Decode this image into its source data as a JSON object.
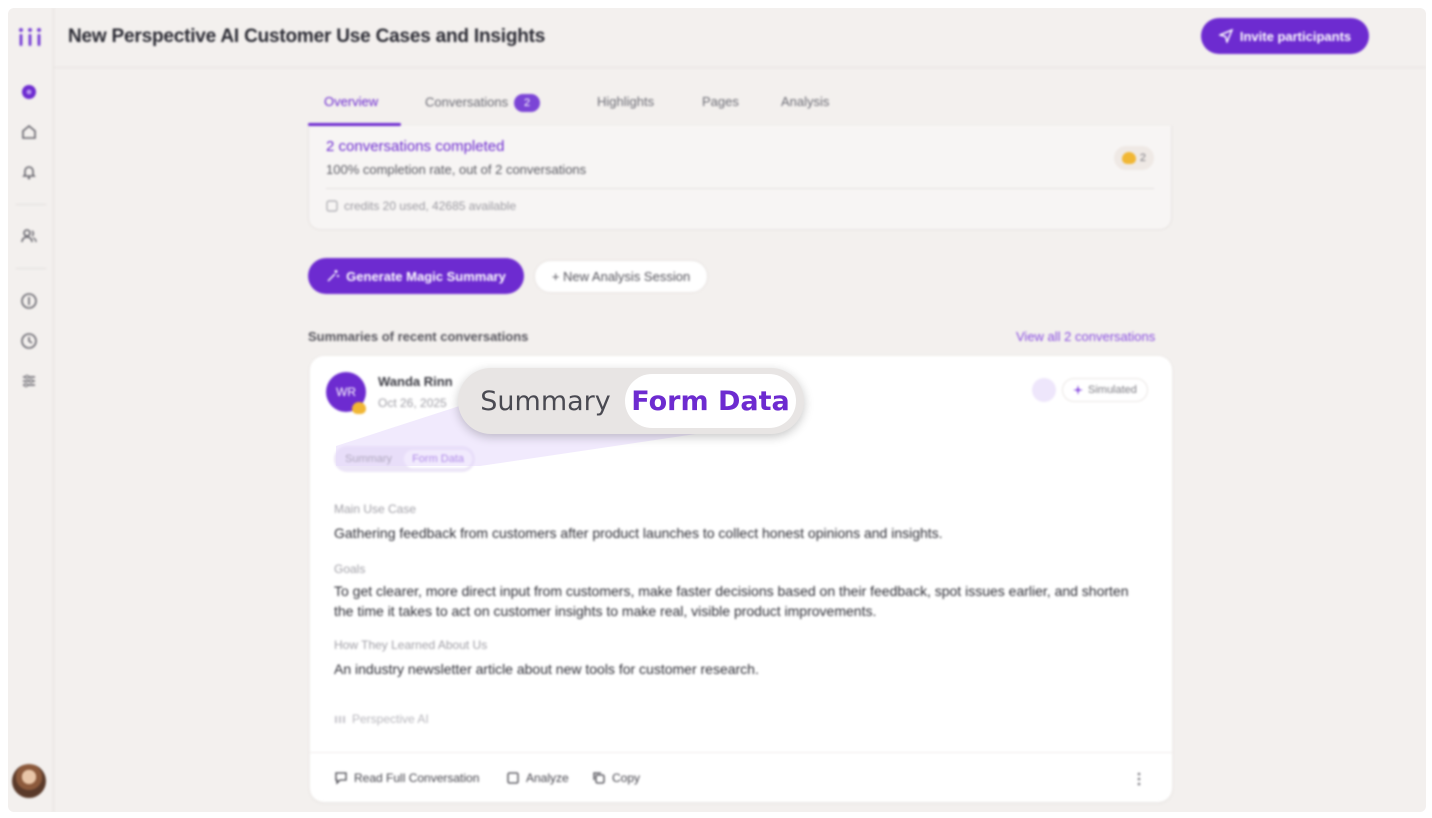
{
  "header": {
    "title": "New Perspective AI Customer Use Cases and Insights",
    "invite_label": "Invite participants"
  },
  "tabs": [
    {
      "label": "Overview",
      "active": true
    },
    {
      "label": "Conversations",
      "badge": "2"
    },
    {
      "label": "Highlights"
    },
    {
      "label": "Pages"
    },
    {
      "label": "Analysis"
    }
  ],
  "status": {
    "title": "2 conversations completed",
    "subtitle": "100% completion rate, out of 2 conversations",
    "credits": "credits 20 used, 42685 available",
    "reaction_count": "2"
  },
  "actions": {
    "magic_summary": "Generate Magic Summary",
    "new_analysis": "+ New Analysis Session"
  },
  "recent": {
    "label": "Summaries of recent conversations",
    "view_all": "View all 2 conversations"
  },
  "card": {
    "initials": "WR",
    "name": "Wanda Rinn",
    "date": "Oct 26, 2025",
    "simulated": "Simulated",
    "toggle": {
      "summary": "Summary",
      "form_data": "Form Data",
      "selected": "Form Data"
    },
    "fields": [
      {
        "label": "Main Use Case",
        "value": "Gathering feedback from customers after product launches to collect honest opinions and insights."
      },
      {
        "label": "Goals",
        "value": "To get clearer, more direct input from customers, make faster decisions based on their feedback, spot issues earlier, and shorten the time it takes to act on customer insights to make real, visible product improvements."
      },
      {
        "label": "How They Learned About Us",
        "value": "An industry newsletter article about new tools for customer research."
      }
    ],
    "source": "Perspective AI",
    "footer": {
      "read": "Read Full Conversation",
      "analyze": "Analyze",
      "copy": "Copy"
    }
  },
  "colors": {
    "accent": "#6d2bd0",
    "background": "#f3f0ee",
    "card": "#ffffff"
  }
}
